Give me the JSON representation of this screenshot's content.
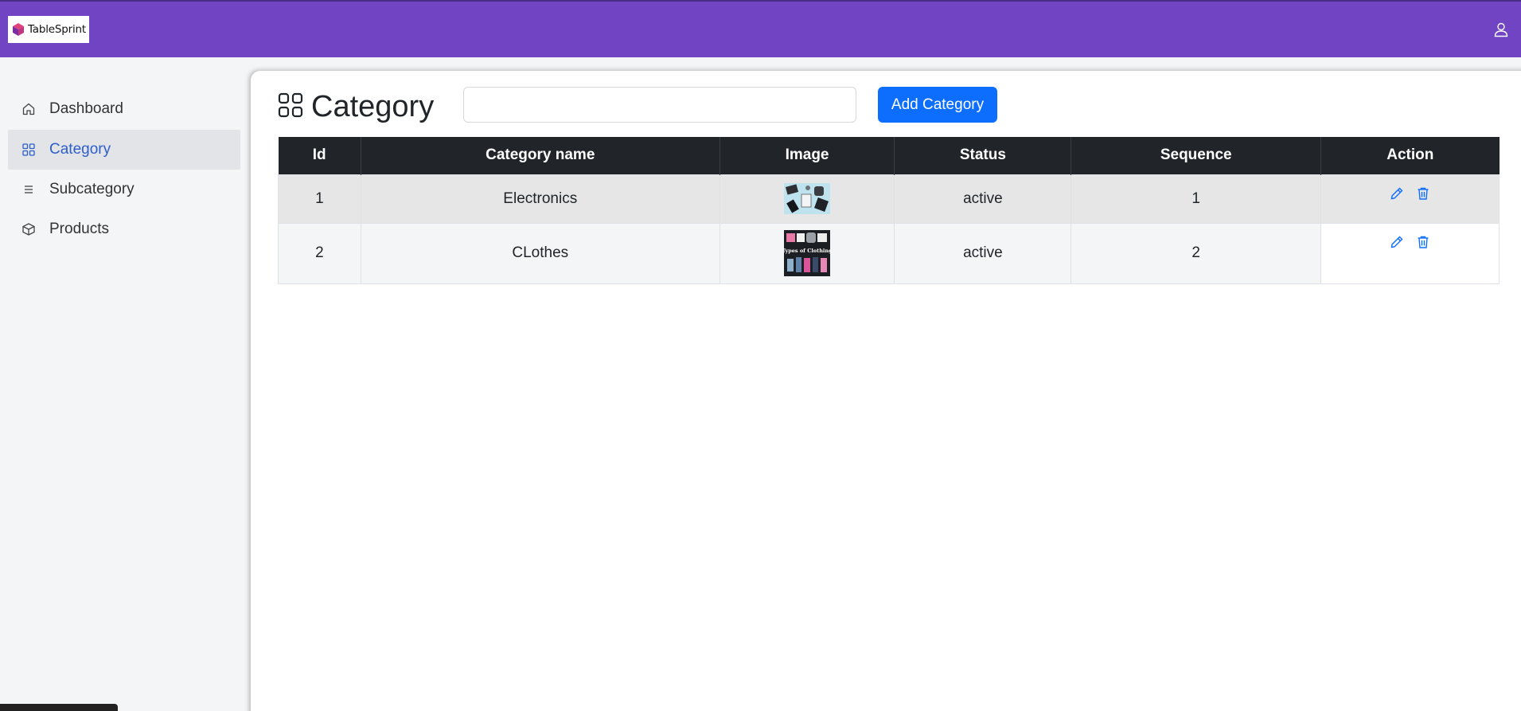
{
  "app": {
    "logo_text": "TableSprint",
    "brand_color": "#7044c2"
  },
  "sidebar": {
    "items": [
      {
        "label": "Dashboard",
        "icon": "home-icon"
      },
      {
        "label": "Category",
        "icon": "grid-icon",
        "active": true
      },
      {
        "label": "Subcategory",
        "icon": "list-icon"
      },
      {
        "label": "Products",
        "icon": "box-icon"
      }
    ]
  },
  "page": {
    "title": "Category",
    "search_value": "",
    "add_button_label": "Add Category"
  },
  "table": {
    "columns": [
      "Id",
      "Category name",
      "Image",
      "Status",
      "Sequence",
      "Action"
    ],
    "rows": [
      {
        "id": "1",
        "name": "Electronics",
        "image": "electronics-thumbnail",
        "status": "active",
        "sequence": "1"
      },
      {
        "id": "2",
        "name": "CLothes",
        "image": "clothing-thumbnail",
        "image_caption": "Types of Clothing",
        "status": "active",
        "sequence": "2"
      }
    ]
  },
  "colors": {
    "primary": "#0d6efd",
    "status_active": "#dc3545",
    "table_header": "#212529",
    "sidebar_active_text": "#2e5ec9"
  }
}
